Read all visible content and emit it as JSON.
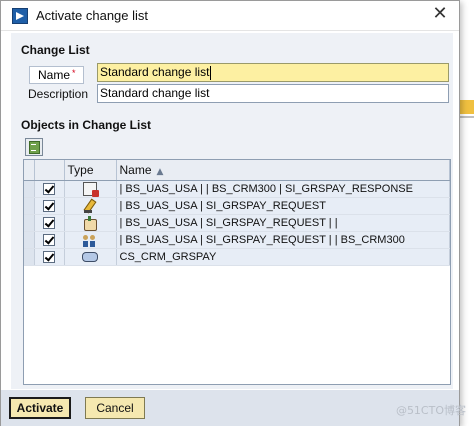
{
  "window": {
    "title": "Activate change list",
    "close_glyph": "✕"
  },
  "change_list": {
    "section_title": "Change List",
    "name_label": "Name",
    "required_mark": "*",
    "name_value": "Standard change list",
    "description_label": "Description",
    "description_value": "Standard change list"
  },
  "objects": {
    "section_title": "Objects in Change List",
    "columns": {
      "type": "Type",
      "name": "Name",
      "sort_glyph": "▲"
    },
    "rows": [
      {
        "checked": true,
        "icon": "clipboard-icon",
        "name": "| BS_UAS_USA | | BS_CRM300 | SI_GRSPAY_RESPONSE"
      },
      {
        "checked": true,
        "icon": "pencil-icon",
        "name": "| BS_UAS_USA | SI_GRSPAY_REQUEST"
      },
      {
        "checked": true,
        "icon": "hand-icon",
        "name": "| BS_UAS_USA | SI_GRSPAY_REQUEST | |"
      },
      {
        "checked": true,
        "icon": "people-icon",
        "name": "| BS_UAS_USA | SI_GRSPAY_REQUEST | | BS_CRM300"
      },
      {
        "checked": true,
        "icon": "capsule-icon",
        "name": "CS_CRM_GRSPAY"
      }
    ]
  },
  "footer": {
    "activate_label": "Activate",
    "cancel_label": "Cancel"
  },
  "watermark": "@51CTO博客",
  "colors": {
    "focused_input": "#fdf0a2",
    "button_bg": "#f5e8b0",
    "row_bg": "#e7edf6",
    "panel_bg": "#eef1f6"
  }
}
